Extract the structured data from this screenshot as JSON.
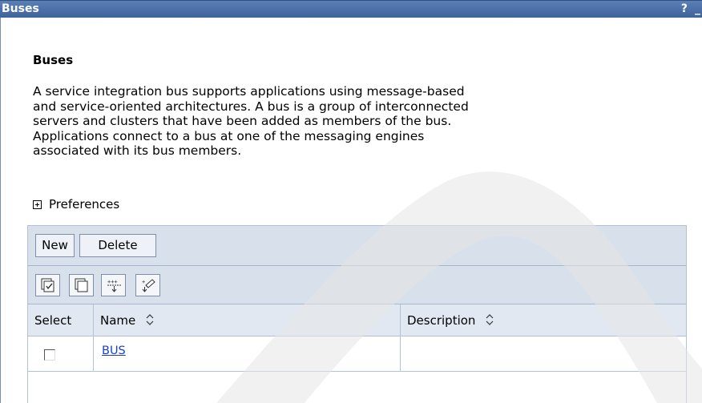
{
  "window": {
    "title": "Buses",
    "help_label": "?",
    "minimize_label": "_"
  },
  "content": {
    "heading": "Buses",
    "description_lines": [
      "A service integration bus supports applications using message-based",
      "and service-oriented architectures. A bus is a group of interconnected",
      "servers and clusters that have been added as members of the bus.",
      "Applications connect to a bus at one of the messaging engines",
      "associated with its bus members."
    ],
    "preferences_label": "Preferences"
  },
  "toolbar": {
    "new_label": "New",
    "delete_label": "Delete",
    "icons": [
      "select-all-icon",
      "deselect-all-icon",
      "show-filter-icon",
      "clear-filter-icon"
    ]
  },
  "table": {
    "columns": [
      {
        "label": "Select",
        "sortable": false
      },
      {
        "label": "Name",
        "sortable": true
      },
      {
        "label": "Description",
        "sortable": true
      }
    ],
    "rows": [
      {
        "selected": false,
        "name": "BUS",
        "description": ""
      }
    ]
  },
  "colors": {
    "titlebar": "#3e6299",
    "toolbar_bg": "#d8e0ec",
    "header_bg": "#e2e8f1",
    "link": "#1a3fcf"
  }
}
